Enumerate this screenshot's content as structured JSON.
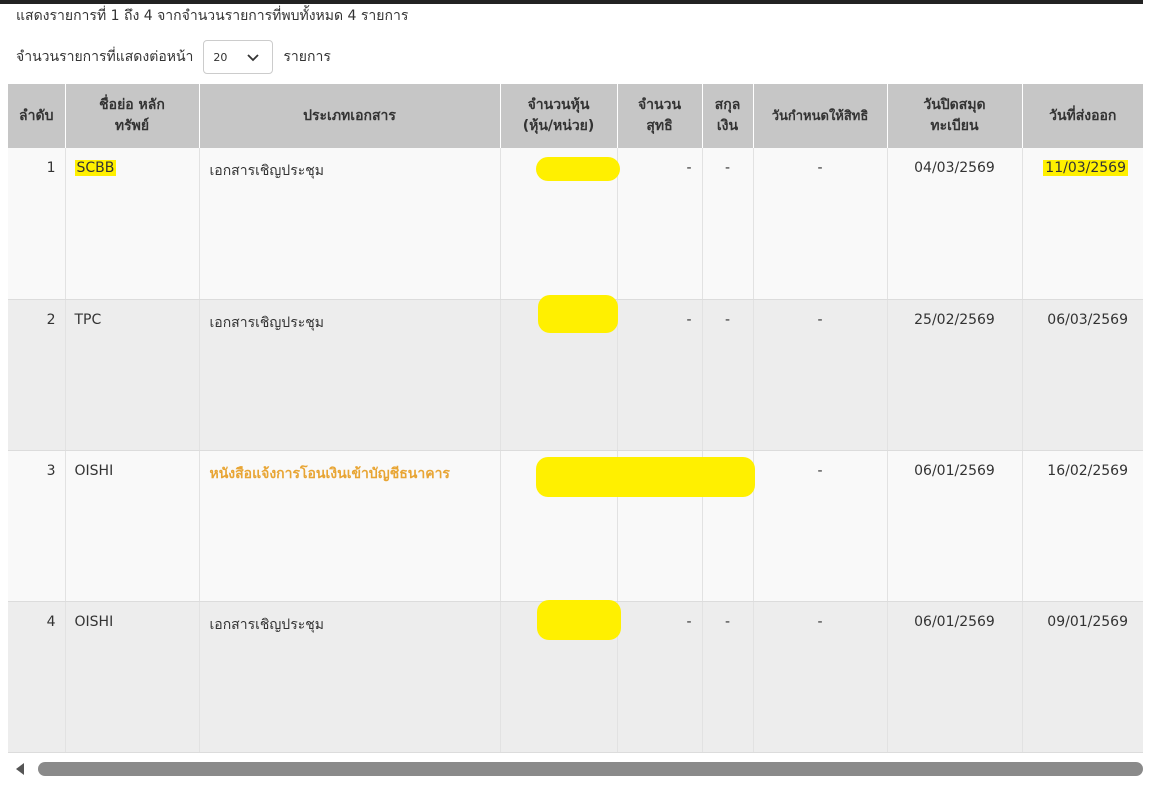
{
  "summary_text": "แสดงรายการที่ 1 ถึง 4 จากจำนวนรายการที่พบทั้งหมด 4 รายการ",
  "page_size": {
    "label": "จำนวนรายการที่แสดงต่อหน้า",
    "value": "20",
    "suffix": "รายการ"
  },
  "table": {
    "headers": {
      "no": "ลำดับ",
      "symbol": "ชื่อย่อ หลักทรัพย์",
      "doc_type": "ประเภทเอกสาร",
      "shares": "จำนวนหุ้น (หุ้น/หน่วย)",
      "net": "จำนวน สุทธิ",
      "currency": "สกุล เงิน",
      "record_date": "วันกำหนดให้สิทธิ",
      "closing_date": "วันปิดสมุด ทะเบียน",
      "issue_date": "วันที่ส่งออก"
    },
    "rows": [
      {
        "no": "1",
        "symbol": "SCBB",
        "doc_type": "เอกสารเชิญประชุม",
        "net": "-",
        "currency": "-",
        "record_date": "-",
        "closing_date": "04/03/2569",
        "issue_date": "11/03/2569"
      },
      {
        "no": "2",
        "symbol": "TPC",
        "doc_type": "เอกสารเชิญประชุม",
        "net": "-",
        "currency": "-",
        "record_date": "-",
        "closing_date": "25/02/2569",
        "issue_date": "06/03/2569"
      },
      {
        "no": "3",
        "symbol": "OISHI",
        "doc_type": "หนังสือแจ้งการโอนเงินเข้าบัญชีธนาคาร",
        "net": "",
        "currency": "",
        "record_date": "-",
        "closing_date": "06/01/2569",
        "issue_date": "16/02/2569"
      },
      {
        "no": "4",
        "symbol": "OISHI",
        "doc_type": "เอกสารเชิญประชุม",
        "net": "-",
        "currency": "-",
        "record_date": "-",
        "closing_date": "06/01/2569",
        "issue_date": "09/01/2569"
      }
    ]
  },
  "colors": {
    "header_bg": "#c6c6c6",
    "highlight": "#fff000",
    "link": "#e8a534"
  },
  "icons": [
    "chevron-down-icon",
    "scroll-left-arrow-icon"
  ]
}
